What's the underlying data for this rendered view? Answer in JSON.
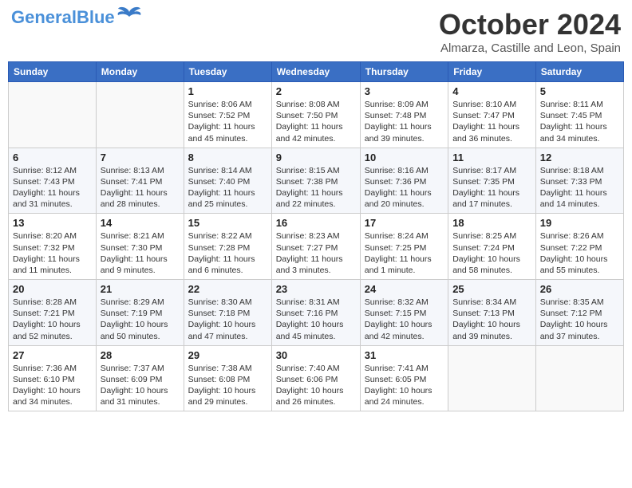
{
  "header": {
    "logo_general": "General",
    "logo_blue": "Blue",
    "month_title": "October 2024",
    "location": "Almarza, Castille and Leon, Spain"
  },
  "weekdays": [
    "Sunday",
    "Monday",
    "Tuesday",
    "Wednesday",
    "Thursday",
    "Friday",
    "Saturday"
  ],
  "weeks": [
    [
      {
        "day": "",
        "info": ""
      },
      {
        "day": "",
        "info": ""
      },
      {
        "day": "1",
        "info": "Sunrise: 8:06 AM\nSunset: 7:52 PM\nDaylight: 11 hours and 45 minutes."
      },
      {
        "day": "2",
        "info": "Sunrise: 8:08 AM\nSunset: 7:50 PM\nDaylight: 11 hours and 42 minutes."
      },
      {
        "day": "3",
        "info": "Sunrise: 8:09 AM\nSunset: 7:48 PM\nDaylight: 11 hours and 39 minutes."
      },
      {
        "day": "4",
        "info": "Sunrise: 8:10 AM\nSunset: 7:47 PM\nDaylight: 11 hours and 36 minutes."
      },
      {
        "day": "5",
        "info": "Sunrise: 8:11 AM\nSunset: 7:45 PM\nDaylight: 11 hours and 34 minutes."
      }
    ],
    [
      {
        "day": "6",
        "info": "Sunrise: 8:12 AM\nSunset: 7:43 PM\nDaylight: 11 hours and 31 minutes."
      },
      {
        "day": "7",
        "info": "Sunrise: 8:13 AM\nSunset: 7:41 PM\nDaylight: 11 hours and 28 minutes."
      },
      {
        "day": "8",
        "info": "Sunrise: 8:14 AM\nSunset: 7:40 PM\nDaylight: 11 hours and 25 minutes."
      },
      {
        "day": "9",
        "info": "Sunrise: 8:15 AM\nSunset: 7:38 PM\nDaylight: 11 hours and 22 minutes."
      },
      {
        "day": "10",
        "info": "Sunrise: 8:16 AM\nSunset: 7:36 PM\nDaylight: 11 hours and 20 minutes."
      },
      {
        "day": "11",
        "info": "Sunrise: 8:17 AM\nSunset: 7:35 PM\nDaylight: 11 hours and 17 minutes."
      },
      {
        "day": "12",
        "info": "Sunrise: 8:18 AM\nSunset: 7:33 PM\nDaylight: 11 hours and 14 minutes."
      }
    ],
    [
      {
        "day": "13",
        "info": "Sunrise: 8:20 AM\nSunset: 7:32 PM\nDaylight: 11 hours and 11 minutes."
      },
      {
        "day": "14",
        "info": "Sunrise: 8:21 AM\nSunset: 7:30 PM\nDaylight: 11 hours and 9 minutes."
      },
      {
        "day": "15",
        "info": "Sunrise: 8:22 AM\nSunset: 7:28 PM\nDaylight: 11 hours and 6 minutes."
      },
      {
        "day": "16",
        "info": "Sunrise: 8:23 AM\nSunset: 7:27 PM\nDaylight: 11 hours and 3 minutes."
      },
      {
        "day": "17",
        "info": "Sunrise: 8:24 AM\nSunset: 7:25 PM\nDaylight: 11 hours and 1 minute."
      },
      {
        "day": "18",
        "info": "Sunrise: 8:25 AM\nSunset: 7:24 PM\nDaylight: 10 hours and 58 minutes."
      },
      {
        "day": "19",
        "info": "Sunrise: 8:26 AM\nSunset: 7:22 PM\nDaylight: 10 hours and 55 minutes."
      }
    ],
    [
      {
        "day": "20",
        "info": "Sunrise: 8:28 AM\nSunset: 7:21 PM\nDaylight: 10 hours and 52 minutes."
      },
      {
        "day": "21",
        "info": "Sunrise: 8:29 AM\nSunset: 7:19 PM\nDaylight: 10 hours and 50 minutes."
      },
      {
        "day": "22",
        "info": "Sunrise: 8:30 AM\nSunset: 7:18 PM\nDaylight: 10 hours and 47 minutes."
      },
      {
        "day": "23",
        "info": "Sunrise: 8:31 AM\nSunset: 7:16 PM\nDaylight: 10 hours and 45 minutes."
      },
      {
        "day": "24",
        "info": "Sunrise: 8:32 AM\nSunset: 7:15 PM\nDaylight: 10 hours and 42 minutes."
      },
      {
        "day": "25",
        "info": "Sunrise: 8:34 AM\nSunset: 7:13 PM\nDaylight: 10 hours and 39 minutes."
      },
      {
        "day": "26",
        "info": "Sunrise: 8:35 AM\nSunset: 7:12 PM\nDaylight: 10 hours and 37 minutes."
      }
    ],
    [
      {
        "day": "27",
        "info": "Sunrise: 7:36 AM\nSunset: 6:10 PM\nDaylight: 10 hours and 34 minutes."
      },
      {
        "day": "28",
        "info": "Sunrise: 7:37 AM\nSunset: 6:09 PM\nDaylight: 10 hours and 31 minutes."
      },
      {
        "day": "29",
        "info": "Sunrise: 7:38 AM\nSunset: 6:08 PM\nDaylight: 10 hours and 29 minutes."
      },
      {
        "day": "30",
        "info": "Sunrise: 7:40 AM\nSunset: 6:06 PM\nDaylight: 10 hours and 26 minutes."
      },
      {
        "day": "31",
        "info": "Sunrise: 7:41 AM\nSunset: 6:05 PM\nDaylight: 10 hours and 24 minutes."
      },
      {
        "day": "",
        "info": ""
      },
      {
        "day": "",
        "info": ""
      }
    ]
  ]
}
